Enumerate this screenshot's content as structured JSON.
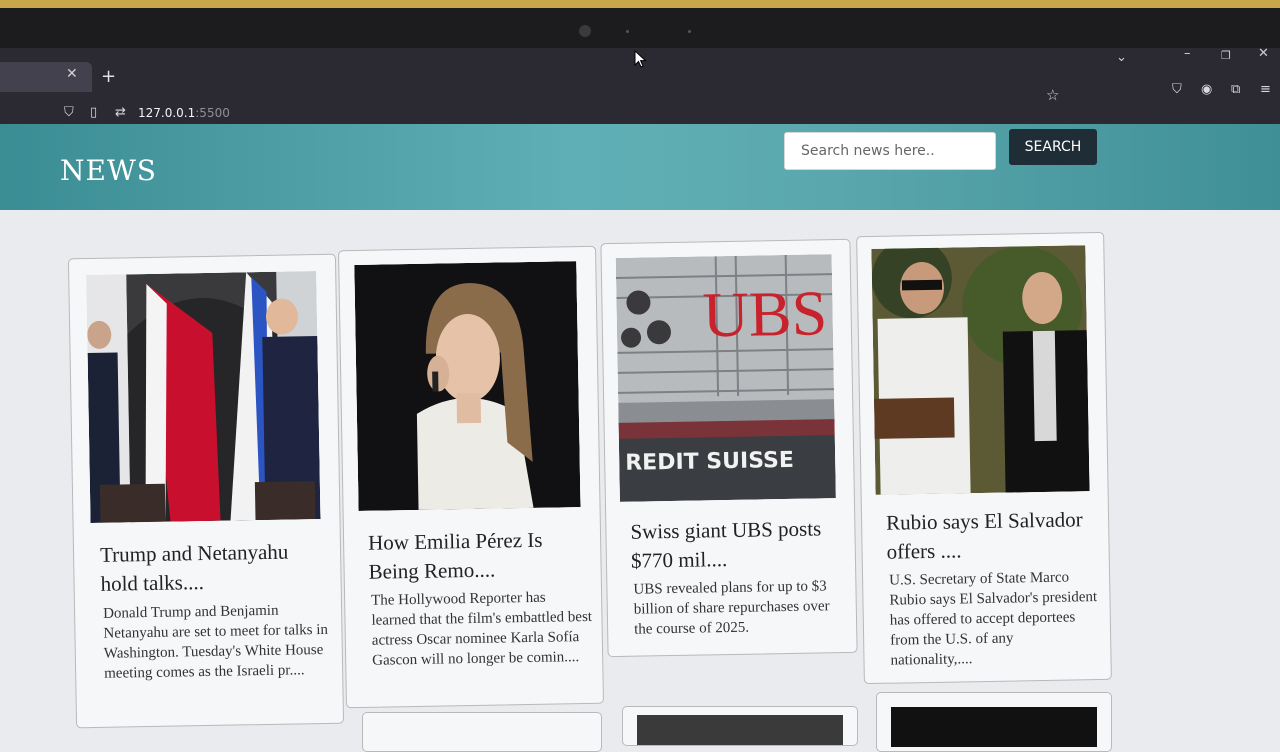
{
  "browser": {
    "tab_close_icon": "close-icon",
    "new_tab_icon": "plus-icon",
    "address": {
      "host": "127.0.0.1",
      "port": ":5500"
    }
  },
  "site": {
    "logo": "NEWS",
    "search": {
      "placeholder": "Search news here..",
      "button": "SEARCH"
    }
  },
  "articles": [
    {
      "title": "Trump and Netanyahu hold talks....",
      "summary": "Donald Trump and Benjamin Netanyahu are set to meet for talks in Washington. Tuesday's White House meeting comes as the Israeli pr...."
    },
    {
      "title": "How Emilia Pérez Is Being Remo....",
      "summary": "The Hollywood Reporter has learned that the film's embattled best actress Oscar nominee Karla Sofía Gascon will no longer be comin...."
    },
    {
      "title": "Swiss giant UBS posts $770 mil....",
      "summary": "UBS revealed plans for up to $3 billion of share repurchases over the course of 2025."
    },
    {
      "title": "Rubio says El Salvador offers ....",
      "summary": "U.S. Secretary of State Marco Rubio says El Salvador's president has offered to accept deportees from the U.S. of any nationality,...."
    }
  ],
  "images": {
    "ubs_sign": "UBS",
    "credit_suisse_sign": "REDIT SUISSE"
  },
  "colors": {
    "header_start": "#3b8d94",
    "header_mid": "#5fb0b6",
    "search_button": "#1f2d36",
    "ubs_red": "#c8232c"
  }
}
